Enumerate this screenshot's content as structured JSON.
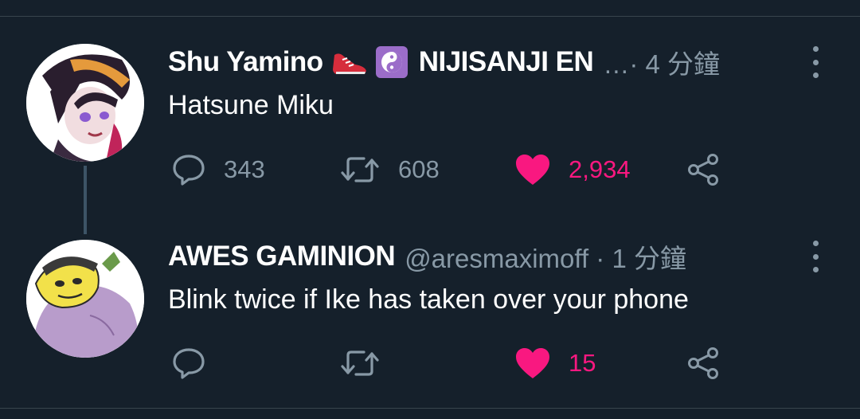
{
  "tweets": [
    {
      "name": "Shu Yamino",
      "badge_icons": [
        "running-shoe-icon",
        "yin-yang-icon"
      ],
      "name_suffix": "NIJISANJI EN",
      "meta": "…· 4 分鐘",
      "text": "Hatsune Miku",
      "reply_count": "343",
      "retweet_count": "608",
      "like_count": "2,934"
    },
    {
      "name": "AWES GAMINION",
      "meta": "@aresmaximoff · 1 分鐘",
      "text": "Blink twice if Ike has taken over your phone",
      "reply_count": "",
      "retweet_count": "",
      "like_count": "15"
    }
  ],
  "colors": {
    "background": "#15202b",
    "secondary_text": "#8899a6",
    "like_pink": "#f91880",
    "divider": "#38444d"
  }
}
